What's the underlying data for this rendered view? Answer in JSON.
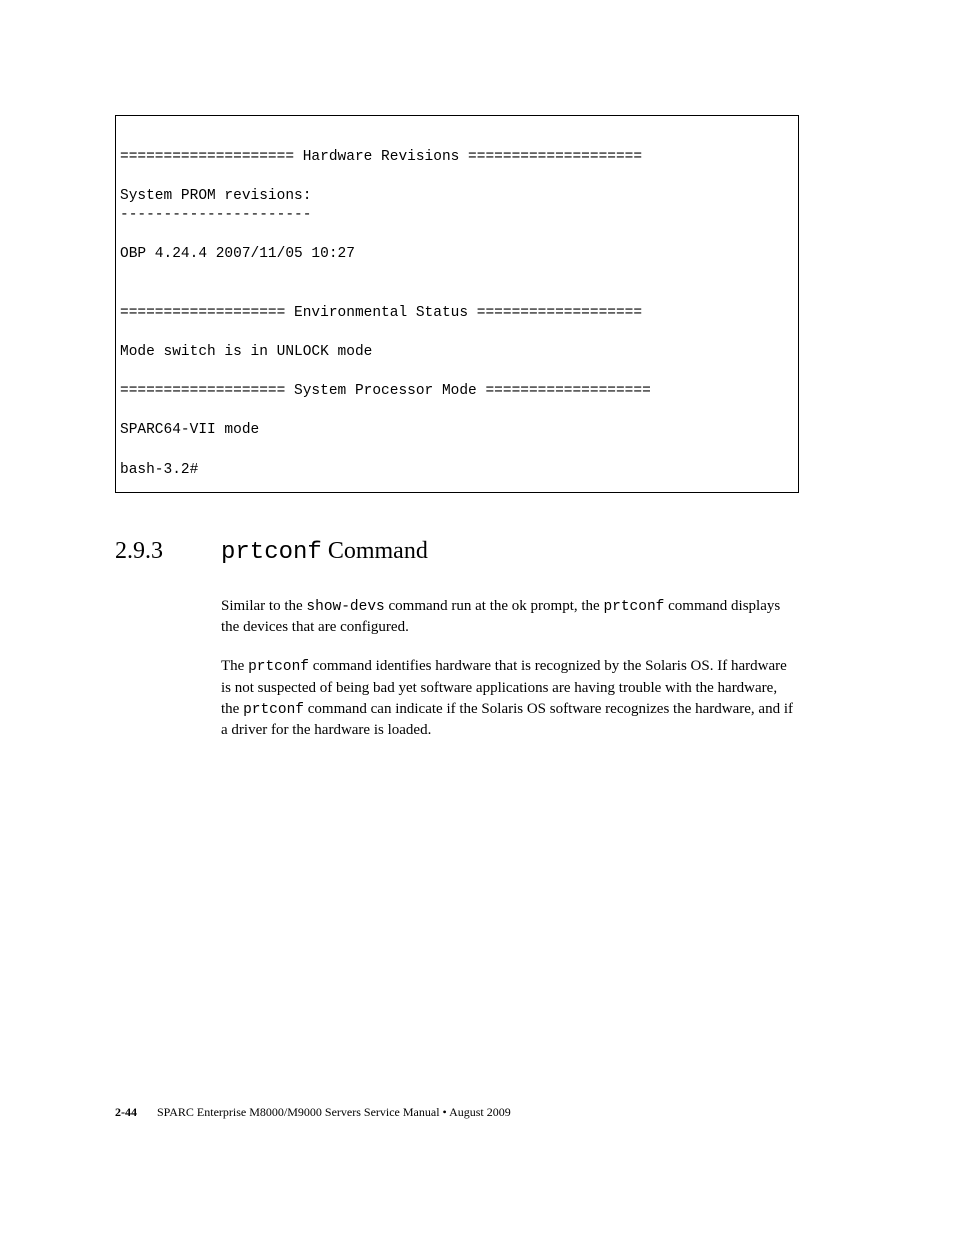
{
  "codeBlock": "\n==================== Hardware Revisions ====================\n\nSystem PROM revisions:\n----------------------\n\nOBP 4.24.4 2007/11/05 10:27\n\n\n=================== Environmental Status ===================\n\nMode switch is in UNLOCK mode\n\n=================== System Processor Mode ===================\n\nSPARC64-VII mode\n\nbash-3.2#",
  "section": {
    "number": "2.9.3",
    "titleMono": "prtconf",
    "titleRest": " Command"
  },
  "paragraphs": {
    "p1_a": "Similar to the ",
    "p1_b": "show-devs",
    "p1_c": " command run at the ok prompt, the ",
    "p1_d": "prtconf",
    "p1_e": " command displays the devices that are configured.",
    "p2_a": "The ",
    "p2_b": "prtconf",
    "p2_c": " command identifies hardware that is recognized by the Solaris OS. If hardware is not suspected of being bad yet software applications are having trouble with the hardware, the ",
    "p2_d": "prtconf",
    "p2_e": " command can indicate if the Solaris OS software recognizes the hardware, and if a driver for the hardware is loaded."
  },
  "footer": {
    "pageNum": "2-44",
    "text": "SPARC Enterprise M8000/M9000 Servers Service Manual • August 2009"
  }
}
